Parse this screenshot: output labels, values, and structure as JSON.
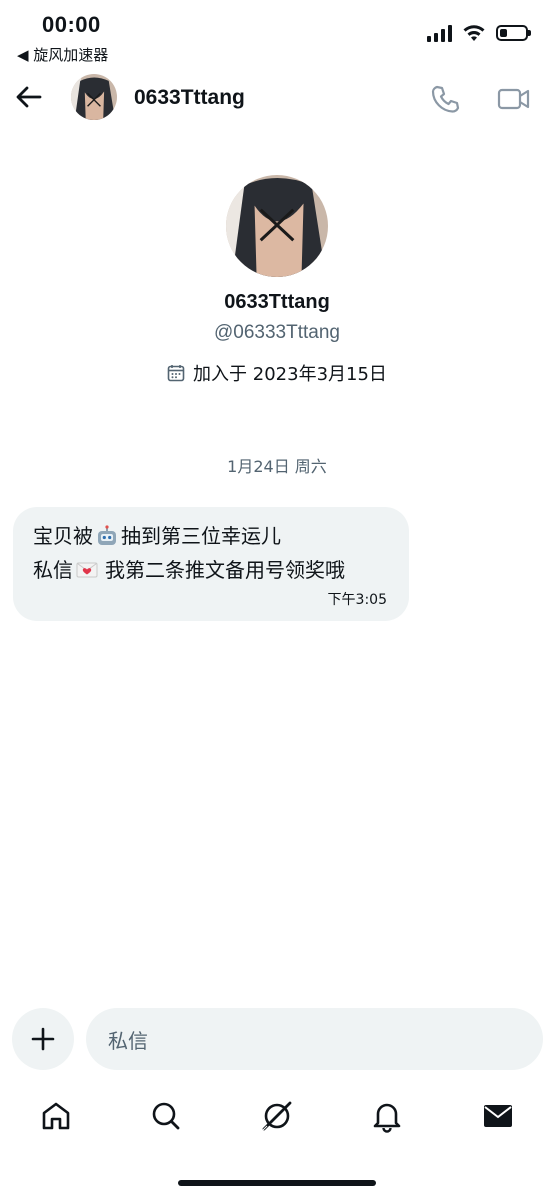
{
  "status_bar": {
    "time": "00:00",
    "back_app_label": "◀ 旋风加速器",
    "battery_level": 0.3
  },
  "header": {
    "name": "0633Tttang"
  },
  "profile": {
    "name": "0633Tttang",
    "handle": "@06333Tttang",
    "joined": "加入于 2023年3月15日"
  },
  "conversation": {
    "date_separator": "1月24日 周六",
    "messages": [
      {
        "line1_part1": "宝贝被",
        "line1_part2": "抽到第三位幸运儿",
        "line2_part1": "私信",
        "line2_part2": "我第二条推文备用号领奖哦",
        "time": "下午3:05"
      }
    ]
  },
  "composer": {
    "placeholder": "私信"
  },
  "nav": [
    "home-icon",
    "search-icon",
    "grok-icon",
    "notifications-icon",
    "messages-icon"
  ]
}
